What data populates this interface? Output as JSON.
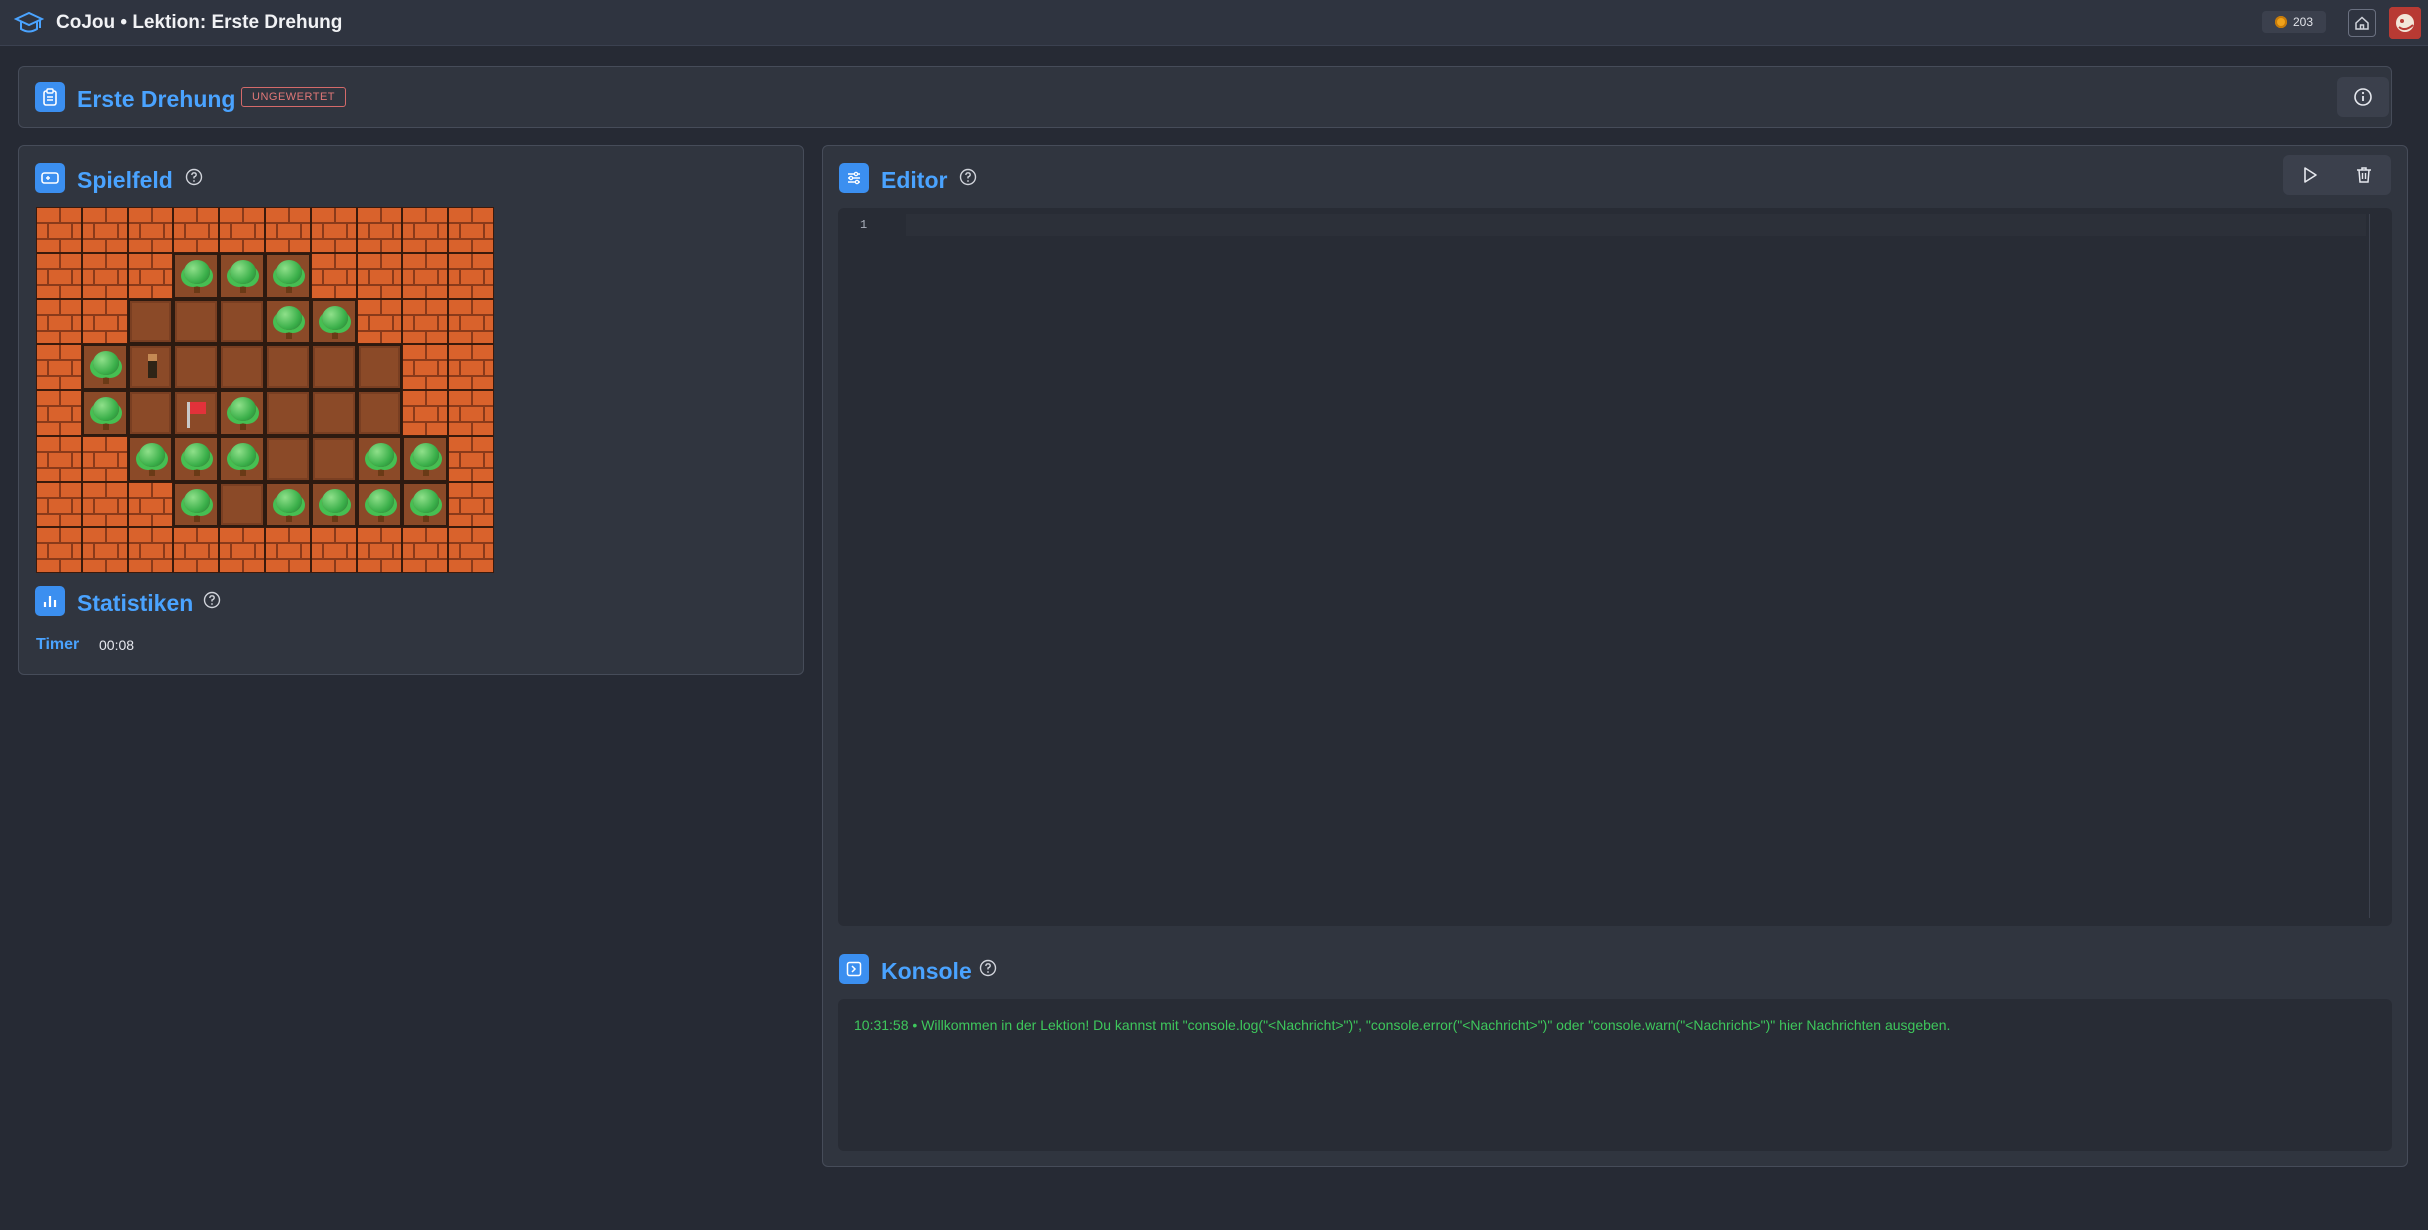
{
  "app": {
    "title": "CoJou • Lektion: Erste Drehung",
    "coins": "203",
    "logo_icon": "graduation-cap-icon",
    "home_icon": "home-icon",
    "avatar_icon": "avatar-icon"
  },
  "lesson": {
    "title": "Erste Drehung",
    "status_badge": "UNGEWERTET",
    "info_icon": "info-icon"
  },
  "spielfeld": {
    "title": "Spielfeld",
    "grid": [
      "WWWWWWWWWW",
      "WWWTTTWWWW",
      "WWFFFTTWWW",
      "WTPFFFFFWW",
      "WTFGTFFFWW",
      "WWTTTFFTTW",
      "WWWTFTTTTW",
      "WWWWWWWWWW"
    ],
    "legend": {
      "W": "wall",
      "F": "floor",
      "T": "tree",
      "P": "player",
      "G": "flag"
    }
  },
  "statistiken": {
    "title": "Statistiken",
    "timer_label": "Timer",
    "timer_value": "00:08"
  },
  "editor": {
    "title": "Editor",
    "line_numbers": [
      "1"
    ],
    "run_icon": "play-icon",
    "clear_icon": "trash-icon"
  },
  "konsole": {
    "title": "Konsole",
    "messages": [
      {
        "time": "10:31:58",
        "text": "Willkommen in der Lektion! Du kannst mit \"console.log(\"<Nachricht>\")\", \"console.error(\"<Nachricht>\")\" oder \"console.warn(\"<Nachricht>\")\" hier Nachrichten ausgeben."
      }
    ]
  },
  "colors": {
    "background": "#262a34",
    "panel": "#30353f",
    "accent": "#4aa3ff",
    "console_text": "#3ec75c",
    "badge_red": "#e07777"
  }
}
